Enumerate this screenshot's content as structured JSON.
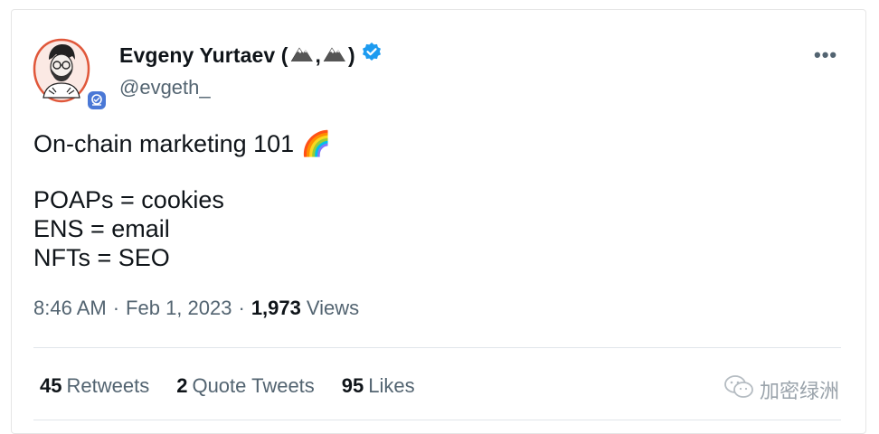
{
  "tweet": {
    "author": {
      "name": "Evgeny Yurtaev (",
      "name_sep": ", ",
      "name_end": ")",
      "handle": "@evgeth_"
    },
    "more_label": "•••",
    "text": {
      "line1": "On-chain marketing 101 🌈",
      "line2": "POAPs = cookies",
      "line3": "ENS = email",
      "line4": "NFTs = SEO"
    },
    "meta": {
      "time": "8:46 AM",
      "sep1": "·",
      "date": "Feb 1, 2023",
      "sep2": "·",
      "views_count": "1,973",
      "views_label": "Views"
    },
    "stats": {
      "retweets_count": "45",
      "retweets_label": "Retweets",
      "quotes_count": "2",
      "quotes_label": "Quote Tweets",
      "likes_count": "95",
      "likes_label": "Likes"
    }
  },
  "watermark": {
    "text": "加密绿洲"
  },
  "colors": {
    "verified": "#1d9bf0",
    "avatar_ring": "#e0573a",
    "secondary_text": "#536471",
    "badge": "#4a78d6"
  },
  "icons": {
    "verified": "verified-badge-icon",
    "more": "more-options-icon",
    "mountain": "mountain-emoji-icon",
    "badge": "affiliate-badge-icon",
    "watermark": "wechat-icon"
  }
}
